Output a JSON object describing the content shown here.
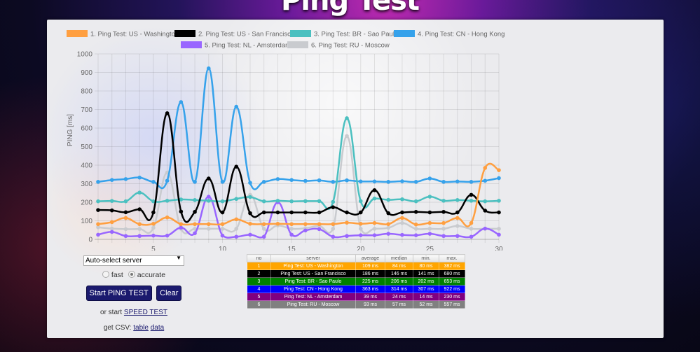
{
  "page": {
    "title": "Ping Test"
  },
  "controls": {
    "server_select": "Auto-select server",
    "mode_options": [
      {
        "label": "fast",
        "selected": false
      },
      {
        "label": "accurate",
        "selected": true
      }
    ],
    "start_button": "Start PING TEST",
    "clear_button": "Clear",
    "speed_prefix": "or start",
    "speed_link": "SPEED TEST",
    "csv_prefix": "get CSV:",
    "csv_table_link": "table",
    "csv_data_link": "data"
  },
  "stats_table": {
    "headers": [
      "no",
      "server",
      "average",
      "median",
      "min.",
      "max."
    ],
    "rows": [
      {
        "no": "1",
        "server": "Ping Test: US - Washington",
        "average": "109 ms",
        "median": "84 ms",
        "min": "80 ms",
        "max": "382 ms",
        "color": "#ffa500"
      },
      {
        "no": "2",
        "server": "Ping Test: US - San Francisco",
        "average": "186 ms",
        "median": "146 ms",
        "min": "141 ms",
        "max": "680 ms",
        "color": "#000000"
      },
      {
        "no": "3",
        "server": "Ping Test: BR - Sao Paulo",
        "average": "225 ms",
        "median": "206 ms",
        "min": "202 ms",
        "max": "653 ms",
        "color": "#008000"
      },
      {
        "no": "4",
        "server": "Ping Test: CN - Hong Kong",
        "average": "363 ms",
        "median": "314 ms",
        "min": "307 ms",
        "max": "922 ms",
        "color": "#0000ff"
      },
      {
        "no": "5",
        "server": "Ping Test: NL - Amsterdam",
        "average": "39 ms",
        "median": "24 ms",
        "min": "14 ms",
        "max": "230 ms",
        "color": "#800080"
      },
      {
        "no": "6",
        "server": "Ping Test: RU - Moscow",
        "average": "93 ms",
        "median": "57 ms",
        "min": "52 ms",
        "max": "557 ms",
        "color": "#808080"
      }
    ]
  },
  "chart_data": {
    "type": "line",
    "title": "",
    "xlabel": "",
    "ylabel": "PING [ms]",
    "ylim": [
      0,
      1000
    ],
    "yticks": [
      0,
      100,
      200,
      300,
      400,
      500,
      600,
      700,
      800,
      900,
      1000
    ],
    "xlim": [
      1,
      30
    ],
    "xticks": [
      5,
      10,
      15,
      20,
      25,
      30
    ],
    "grid": true,
    "legend": "top-center",
    "x": [
      1,
      2,
      3,
      4,
      5,
      6,
      7,
      8,
      9,
      10,
      11,
      12,
      13,
      14,
      15,
      16,
      17,
      18,
      19,
      20,
      21,
      22,
      23,
      24,
      25,
      26,
      27,
      28,
      29,
      30
    ],
    "series": [
      {
        "name": "1. Ping Test: US - Washington",
        "color": "#ff9f40",
        "values": [
          82,
          93,
          115,
          82,
          84,
          118,
          82,
          82,
          82,
          82,
          108,
          84,
          82,
          84,
          82,
          82,
          82,
          82,
          90,
          84,
          88,
          82,
          115,
          80,
          88,
          88,
          115,
          88,
          385,
          373
        ]
      },
      {
        "name": "2. Ping Test: US - San Francisco",
        "color": "#000000",
        "values": [
          158,
          156,
          146,
          162,
          145,
          680,
          150,
          148,
          328,
          145,
          392,
          141,
          145,
          145,
          145,
          145,
          145,
          173,
          145,
          145,
          265,
          141,
          145,
          148,
          145,
          148,
          145,
          240,
          155,
          145
        ]
      },
      {
        "name": "3. Ping Test: BR - Sao Paulo",
        "color": "#4bc0c0",
        "values": [
          205,
          207,
          205,
          252,
          205,
          208,
          215,
          212,
          208,
          205,
          218,
          228,
          205,
          208,
          205,
          206,
          206,
          202,
          653,
          206,
          220,
          213,
          216,
          205,
          230,
          208,
          212,
          208,
          205,
          208
        ]
      },
      {
        "name": "4. Ping Test: CN - Hong Kong",
        "color": "#36a2eb",
        "values": [
          310,
          320,
          325,
          333,
          310,
          316,
          740,
          310,
          922,
          310,
          715,
          305,
          310,
          325,
          320,
          315,
          318,
          310,
          318,
          312,
          312,
          310,
          313,
          310,
          328,
          310,
          312,
          310,
          316,
          330
        ]
      },
      {
        "name": "5. Ping Test: NL - Amsterdam",
        "color": "#9966ff",
        "values": [
          25,
          40,
          18,
          18,
          20,
          20,
          63,
          33,
          230,
          20,
          14,
          25,
          14,
          200,
          25,
          48,
          55,
          14,
          18,
          22,
          22,
          30,
          24,
          22,
          30,
          18,
          18,
          14,
          58,
          25
        ]
      },
      {
        "name": "6. Ping Test: RU - Moscow",
        "color": "#c9cbcf",
        "values": [
          65,
          58,
          55,
          56,
          62,
          360,
          57,
          57,
          57,
          57,
          57,
          240,
          57,
          75,
          57,
          60,
          72,
          57,
          557,
          57,
          57,
          62,
          88,
          57,
          57,
          57,
          72,
          57,
          57,
          57
        ]
      }
    ]
  }
}
